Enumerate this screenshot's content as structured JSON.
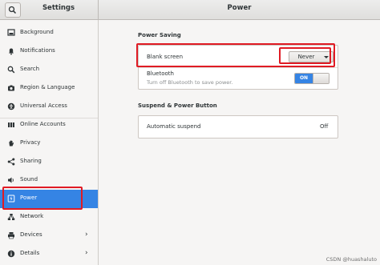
{
  "window": {
    "left_title": "Settings",
    "right_title": "Power"
  },
  "sidebar": {
    "items": [
      {
        "label": "Background",
        "icon": "background-icon",
        "chevron": ""
      },
      {
        "label": "Notifications",
        "icon": "bell-icon",
        "chevron": ""
      },
      {
        "label": "Search",
        "icon": "search-icon",
        "chevron": ""
      },
      {
        "label": "Region & Language",
        "icon": "camera-icon",
        "chevron": ""
      },
      {
        "label": "Universal Access",
        "icon": "accessibility-icon",
        "chevron": ""
      },
      {
        "label": "Online Accounts",
        "icon": "online-accounts-icon",
        "chevron": ""
      },
      {
        "label": "Privacy",
        "icon": "hand-icon",
        "chevron": ""
      },
      {
        "label": "Sharing",
        "icon": "share-icon",
        "chevron": ""
      },
      {
        "label": "Sound",
        "icon": "speaker-icon",
        "chevron": ""
      },
      {
        "label": "Power",
        "icon": "power-icon",
        "chevron": ""
      },
      {
        "label": "Network",
        "icon": "network-icon",
        "chevron": ""
      },
      {
        "label": "Devices",
        "icon": "printer-icon",
        "chevron": "›"
      },
      {
        "label": "Details",
        "icon": "info-icon",
        "chevron": "›"
      }
    ],
    "selected": "Power"
  },
  "power_saving": {
    "title": "Power Saving",
    "blank_screen": {
      "label": "Blank screen",
      "value": "Never"
    },
    "bluetooth": {
      "label": "Bluetooth",
      "description": "Turn off Bluetooth to save power.",
      "state": "ON"
    }
  },
  "suspend": {
    "title": "Suspend & Power Button",
    "automatic_suspend": {
      "label": "Automatic suspend",
      "value": "Off"
    }
  },
  "watermark": "CSDN @huashaluto",
  "colors": {
    "accent": "#3584e4",
    "highlight": "#e01b24"
  }
}
